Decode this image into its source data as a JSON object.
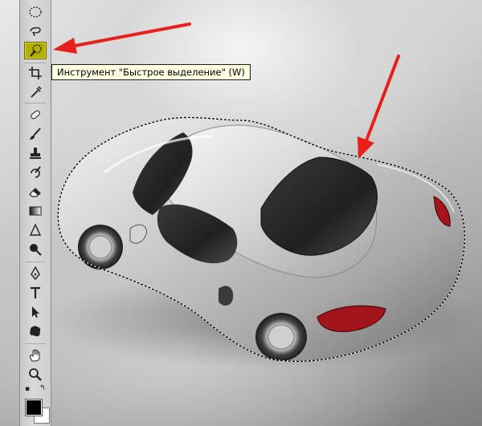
{
  "tooltip": {
    "text": "Инструмент \"Быстрое выделение\" (W)"
  },
  "toolbar": {
    "tools": [
      {
        "name": "marquee-tool-icon"
      },
      {
        "name": "lasso-tool-icon"
      },
      {
        "name": "quick-selection-tool-icon",
        "active": true
      },
      {
        "name": "crop-tool-icon"
      },
      {
        "name": "eyedropper-tool-icon"
      },
      {
        "name": "healing-brush-tool-icon"
      },
      {
        "name": "brush-tool-icon"
      },
      {
        "name": "clone-stamp-tool-icon"
      },
      {
        "name": "history-brush-tool-icon"
      },
      {
        "name": "eraser-tool-icon"
      },
      {
        "name": "gradient-tool-icon"
      },
      {
        "name": "blur-tool-icon"
      },
      {
        "name": "dodge-tool-icon"
      },
      {
        "name": "pen-tool-icon"
      },
      {
        "name": "type-tool-icon"
      },
      {
        "name": "path-selection-tool-icon"
      },
      {
        "name": "custom-shape-tool-icon"
      },
      {
        "name": "hand-tool-icon"
      },
      {
        "name": "zoom-tool-icon"
      }
    ],
    "active_color": "#b3b000",
    "foreground_color": "#000000",
    "background_color": "#ffffff"
  },
  "annotation_color": "#e8201c"
}
